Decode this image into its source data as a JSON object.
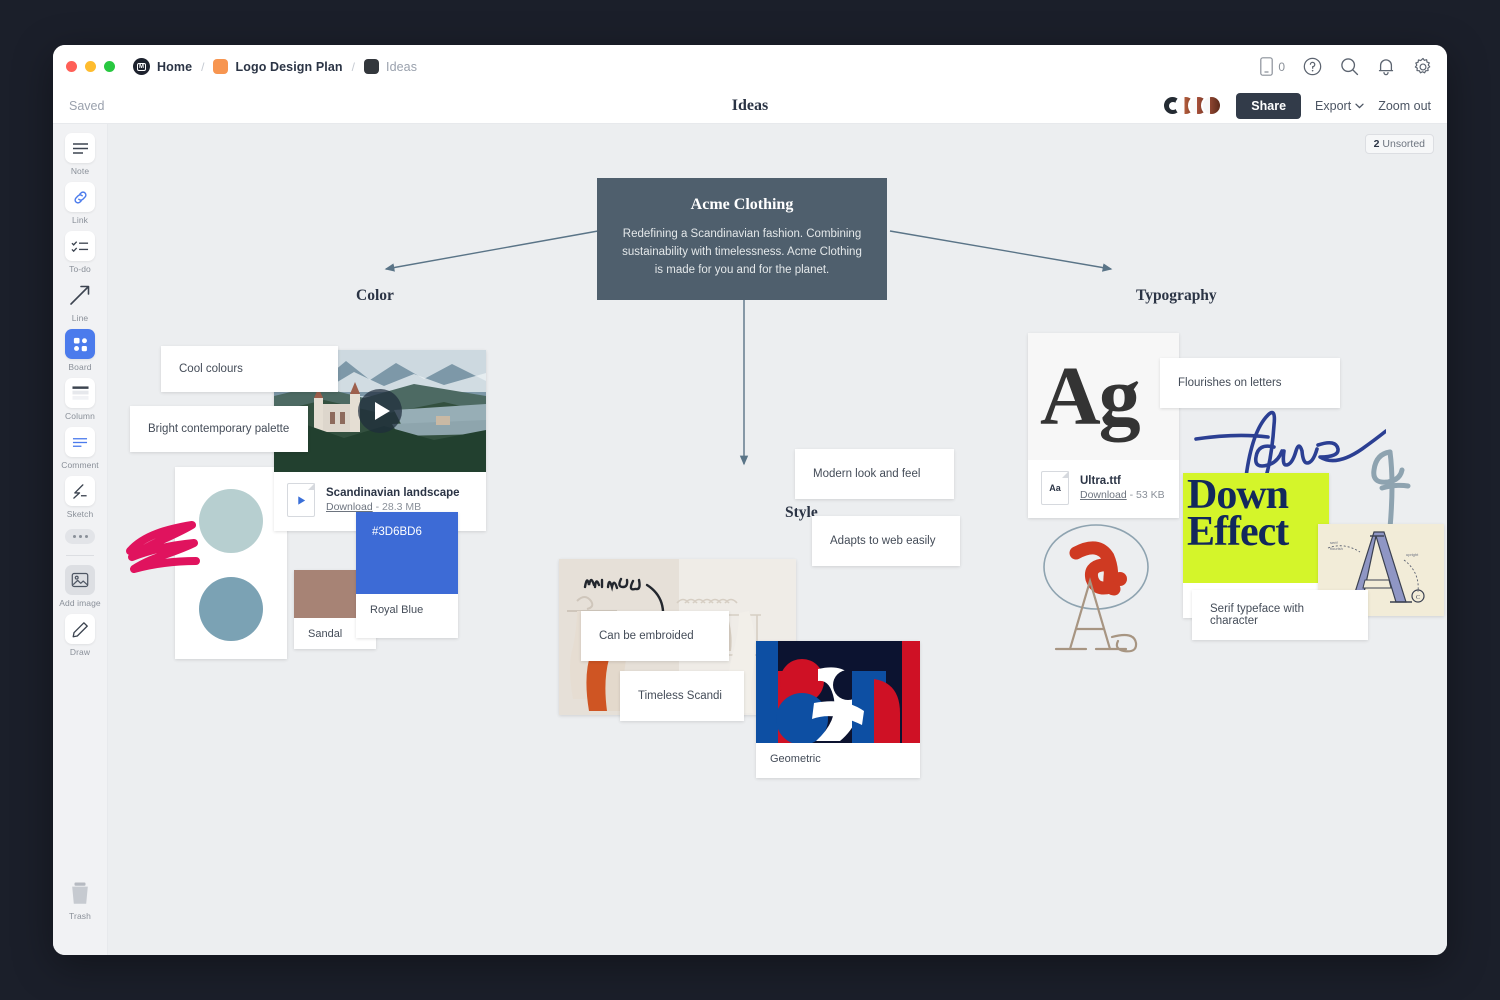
{
  "window": {
    "breadcrumb": [
      {
        "label": "Home",
        "icon": "app-logo-icon",
        "muted": false
      },
      {
        "label": "Logo Design Plan",
        "icon": "orange-square-icon",
        "muted": false
      },
      {
        "label": "Ideas",
        "icon": "dark-square-icon",
        "muted": true
      }
    ],
    "separator": "/",
    "device_count": "0"
  },
  "subbar": {
    "save_status": "Saved",
    "board_title": "Ideas",
    "share_label": "Share",
    "export_label": "Export",
    "zoom_label": "Zoom out"
  },
  "sidebar": {
    "items": [
      {
        "label": "Note",
        "icon": "note-icon"
      },
      {
        "label": "Link",
        "icon": "link-icon"
      },
      {
        "label": "To-do",
        "icon": "todo-icon"
      },
      {
        "label": "Line",
        "icon": "line-arrow-icon"
      },
      {
        "label": "Board",
        "icon": "board-icon",
        "active": true
      },
      {
        "label": "Column",
        "icon": "column-icon"
      },
      {
        "label": "Comment",
        "icon": "comment-icon"
      },
      {
        "label": "Sketch",
        "icon": "sketch-icon"
      }
    ],
    "more_label": "more-options-icon",
    "lower_items": [
      {
        "label": "Add image",
        "icon": "add-image-icon"
      },
      {
        "label": "Draw",
        "icon": "pencil-icon"
      }
    ],
    "trash_label": "Trash"
  },
  "canvas": {
    "unsorted_count": "2",
    "unsorted_label": "Unsorted",
    "root": {
      "title": "Acme Clothing",
      "description": "Redefining a Scandinavian fashion. Combining sustainability with timelessness. Acme Clothing is made for you and for the planet."
    },
    "branches": [
      {
        "title": "Color"
      },
      {
        "title": "Style"
      },
      {
        "title": "Typography"
      }
    ],
    "color_section": {
      "notes": [
        {
          "text": "Cool colours"
        },
        {
          "text": "Bright contemporary palette"
        }
      ],
      "video": {
        "name": "Scandinavian landscape",
        "download_label": "Download",
        "size": "28.3 MB"
      },
      "swatches": [
        {
          "name": "Sandal",
          "hex": "#a78375"
        },
        {
          "name": "Royal Blue",
          "hex": "#3D6BD6",
          "code": "#3D6BD6"
        }
      ],
      "circles": [
        "#b7cfd0",
        "#7ba2b4"
      ],
      "scribble_color": "#e0135e"
    },
    "style_section": {
      "notes": [
        {
          "text": "Modern look and feel"
        },
        {
          "text": "Adapts to web easily"
        },
        {
          "text": "Can be embroided"
        },
        {
          "text": "Timeless Scandi"
        }
      ],
      "sketch_word": "Minimal",
      "image_caption": "Geometric"
    },
    "typography_section": {
      "notes": [
        {
          "text": "Flourishes on letters"
        },
        {
          "text": "Serif typeface"
        },
        {
          "text": "Serif typeface with character"
        }
      ],
      "specimen_sample": "Ag",
      "font_file": {
        "name": "Ultra.ttf",
        "download_label": "Download",
        "size": "53 KB",
        "icon_label": "Aa"
      },
      "signature": "Acme",
      "poster_lines": [
        "Down",
        "Effect"
      ],
      "poster_bg": "#d4f52a",
      "poster_fg": "#12285c"
    }
  }
}
